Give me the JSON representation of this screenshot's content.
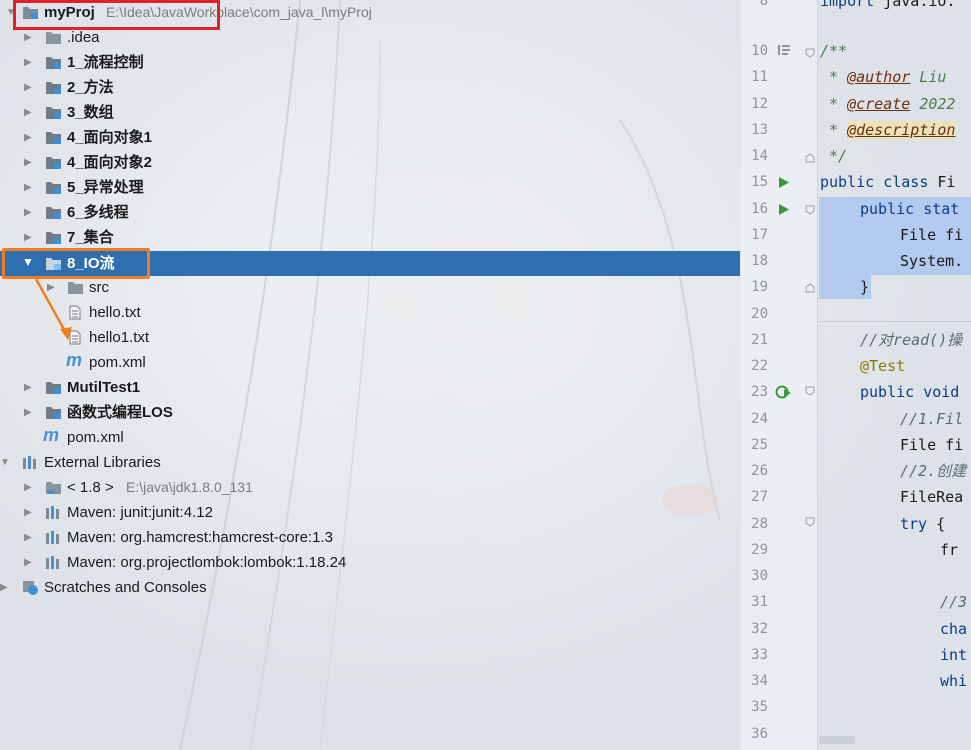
{
  "project": {
    "root_name": "myProj",
    "root_path": "E:\\Idea\\JavaWorkplace\\com_java_l\\myProj",
    "items": [
      {
        "label": ".idea",
        "bold": false
      },
      {
        "label": "1_流程控制",
        "bold": true
      },
      {
        "label": "2_方法",
        "bold": true
      },
      {
        "label": "3_数组",
        "bold": true
      },
      {
        "label": "4_面向对象1",
        "bold": true
      },
      {
        "label": "4_面向对象2",
        "bold": true
      },
      {
        "label": "5_异常处理",
        "bold": true
      },
      {
        "label": "6_多线程",
        "bold": true
      },
      {
        "label": "7_集合",
        "bold": true
      },
      {
        "label": "8_IO流",
        "bold": true,
        "selected": true
      },
      {
        "label": "src"
      },
      {
        "label": "hello.txt"
      },
      {
        "label": "hello1.txt"
      },
      {
        "label": "pom.xml"
      },
      {
        "label": "MutilTest1",
        "bold": true
      },
      {
        "label": "函数式编程LOS",
        "bold": true
      },
      {
        "label": "pom.xml"
      }
    ],
    "external_libraries_label": "External Libraries",
    "libraries": [
      {
        "label": "< 1.8 >",
        "path": "E:\\java\\jdk1.8.0_131"
      },
      {
        "label": "Maven: junit:junit:4.12"
      },
      {
        "label": "Maven: org.hamcrest:hamcrest-core:1.3"
      },
      {
        "label": "Maven: org.projectlombok:lombok:1.18.24"
      }
    ],
    "scratches_label": "Scratches and Consoles"
  },
  "editor": {
    "line_numbers": [
      "8",
      "10",
      "11",
      "12",
      "13",
      "14",
      "15",
      "16",
      "17",
      "18",
      "19",
      "20",
      "21",
      "22",
      "23",
      "24",
      "25",
      "26",
      "27",
      "28",
      "29",
      "30",
      "31",
      "32",
      "33",
      "34",
      "35",
      "36"
    ],
    "code": {
      "l8_kw": "import",
      "l8": " java.io.",
      "l10": "/**",
      "l11_pre": " * ",
      "l11_tag": "@author",
      "l11_txt": " Liu",
      "l12_pre": " * ",
      "l12_tag": "@create",
      "l12_txt": " 2022",
      "l13_pre": " * ",
      "l13_tag": "@description",
      "l14": " */",
      "l15_kw": "public class",
      "l15": " Fi",
      "l16_kw": "public stat",
      "l17": "File fi",
      "l18": "System.",
      "l19": "}",
      "l21": "//对read()操",
      "l22": "@Test",
      "l23_kw": "public void",
      "l24": "//1.Fil",
      "l25": "File fi",
      "l26": "//2.创建",
      "l27": "FileRea",
      "l28_kw": "try",
      "l28": " {",
      "l29": "fr",
      "l31": "//3",
      "l32": "cha",
      "l33": "int",
      "l34": "whi"
    }
  },
  "colors": {
    "selection": "#2f6fb0",
    "red_box": "#e0202a",
    "orange_box": "#f07d1e",
    "folder": "#7f8c99",
    "module_blue": "#3d8fd6",
    "maven_m": "#4a90d9"
  }
}
